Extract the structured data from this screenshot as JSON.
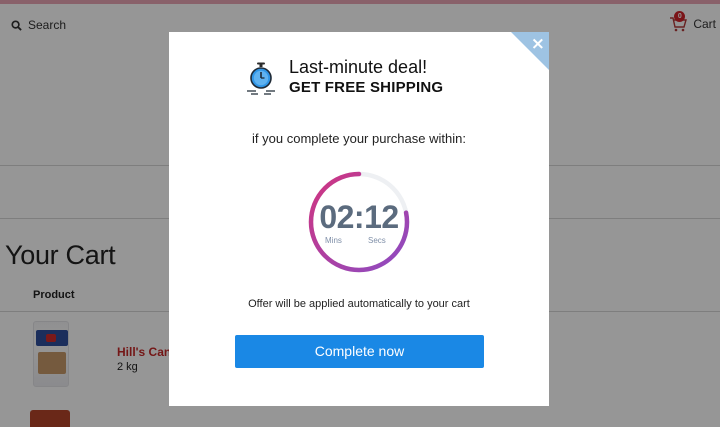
{
  "header": {
    "search_label": "Search",
    "cart_label": "Cart",
    "cart_count": "0"
  },
  "page": {
    "title": "Your Cart",
    "column_product": "Product",
    "items": [
      {
        "name": "Hill's Canine",
        "size": "2 kg"
      }
    ]
  },
  "modal": {
    "close_symbol": "×",
    "headline": "Last-minute deal!",
    "subheadline": "GET FREE SHIPPING",
    "subtitle": "if you complete your purchase within:",
    "timer": {
      "value": "02:12",
      "mins_label": "Mins",
      "secs_label": "Secs",
      "remaining_fraction": 0.78
    },
    "note": "Offer will be applied automatically to your cart",
    "cta_label": "Complete now"
  },
  "colors": {
    "accent": "#1a88e5",
    "brand_stripe": "#e9a6b4",
    "timer_gradient_start": "#8b4cc4",
    "timer_gradient_end": "#d1347f",
    "product_name": "#c62828"
  }
}
